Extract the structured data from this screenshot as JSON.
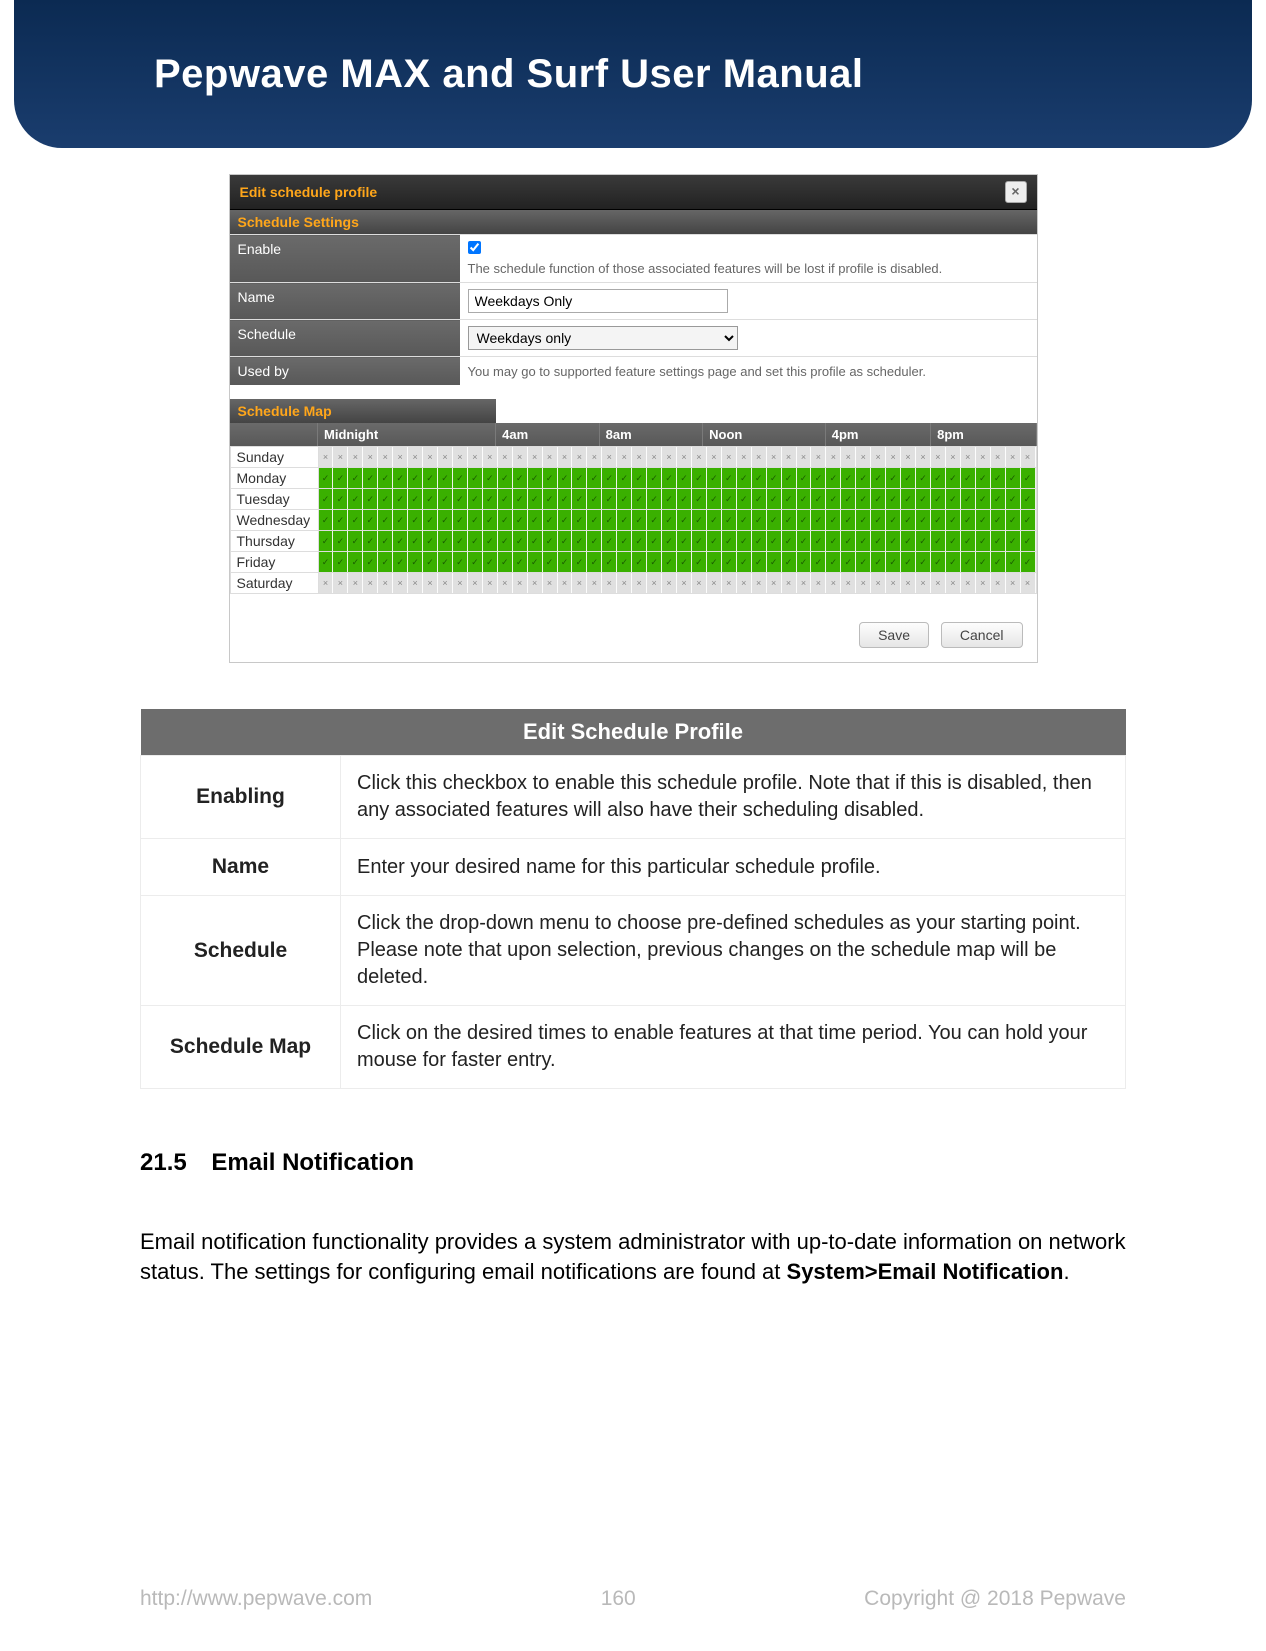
{
  "header": {
    "title": "Pepwave MAX and Surf User Manual"
  },
  "dialog": {
    "title": "Edit schedule profile",
    "section_settings": "Schedule Settings",
    "rows": {
      "enable": {
        "label": "Enable",
        "checked": true,
        "desc": "The schedule function of those associated features will be lost if profile is disabled."
      },
      "name": {
        "label": "Name",
        "value": "Weekdays Only"
      },
      "schedule": {
        "label": "Schedule",
        "value": "Weekdays only"
      },
      "used_by": {
        "label": "Used by",
        "desc": "You may go to supported feature settings page and set this profile as scheduler."
      }
    },
    "section_map": "Schedule Map",
    "hour_labels": [
      "Midnight",
      "4am",
      "8am",
      "Noon",
      "4pm",
      "8pm"
    ],
    "days": [
      {
        "name": "Sunday",
        "on": false
      },
      {
        "name": "Monday",
        "on": true
      },
      {
        "name": "Tuesday",
        "on": true
      },
      {
        "name": "Wednesday",
        "on": true
      },
      {
        "name": "Thursday",
        "on": true
      },
      {
        "name": "Friday",
        "on": true
      },
      {
        "name": "Saturday",
        "on": false
      }
    ],
    "slots_per_day": 48,
    "buttons": {
      "save": "Save",
      "cancel": "Cancel"
    }
  },
  "def_table": {
    "header": "Edit Schedule Profile",
    "rows": [
      {
        "term": "Enabling",
        "desc": "Click this checkbox to enable this schedule profile. Note that if this is disabled, then any associated features will also have their scheduling disabled."
      },
      {
        "term": "Name",
        "desc": "Enter your desired name for this particular schedule profile."
      },
      {
        "term": "Schedule",
        "desc": "Click the drop-down menu to choose pre-defined schedules as your starting point. Please note that upon selection, previous changes on the schedule map will be deleted."
      },
      {
        "term": "Schedule Map",
        "desc": "Click on the desired times to enable features at that time period. You can hold your mouse for faster entry."
      }
    ]
  },
  "section": {
    "number": "21.5",
    "title": "Email Notification",
    "para_pre": "Email notification functionality provides a system administrator with up-to-date information on network status. The settings for configuring email notifications are found at ",
    "para_bold": "System>Email Notification",
    "para_post": "."
  },
  "footer": {
    "url": "http://www.pepwave.com",
    "page": "160",
    "copyright": "Copyright @ 2018 Pepwave"
  }
}
